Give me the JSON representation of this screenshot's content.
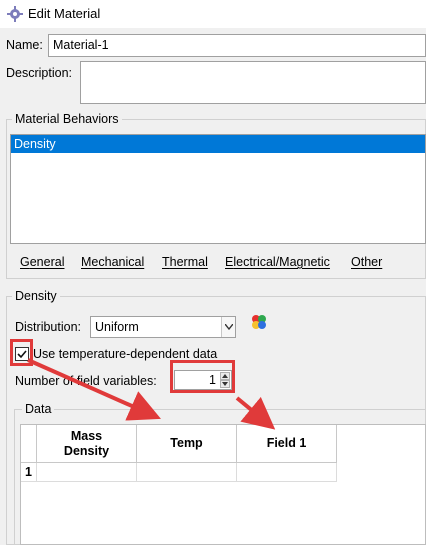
{
  "window": {
    "title": "Edit Material",
    "icon": "gear-icon"
  },
  "name_field": {
    "label": "Name:",
    "value": "Material-1"
  },
  "description_field": {
    "label": "Description:",
    "value": ""
  },
  "behaviors": {
    "title": "Material Behaviors",
    "items": [
      "Density"
    ],
    "selected_index": 0,
    "menu": [
      {
        "key": "G",
        "rest": "eneral"
      },
      {
        "key": "M",
        "rest": "echanical"
      },
      {
        "key": "T",
        "rest": "hermal"
      },
      {
        "key": "E",
        "rest": "lectrical/Magnetic"
      },
      {
        "key": "O",
        "rest": "ther"
      }
    ]
  },
  "density": {
    "title": "Density",
    "distribution_label": "Distribution:",
    "distribution_value": "Uniform",
    "use_temp_label": "Use temperature-dependent data",
    "use_temp_checked": true,
    "field_vars_label": "Number of field variables:",
    "field_vars_value": "1"
  },
  "data_table": {
    "title": "Data",
    "columns": [
      "Mass\nDensity",
      "Temp",
      "Field 1"
    ],
    "rows": [
      {
        "index": "1",
        "cells": [
          "",
          "",
          ""
        ]
      }
    ]
  },
  "colors": {
    "selection": "#0078d7",
    "annotation_red": "#e03a3a"
  },
  "icons": [
    "gear-icon",
    "chevron-down-icon",
    "color-palette-icon",
    "check-icon",
    "arrow-up-icon",
    "arrow-down-icon"
  ]
}
